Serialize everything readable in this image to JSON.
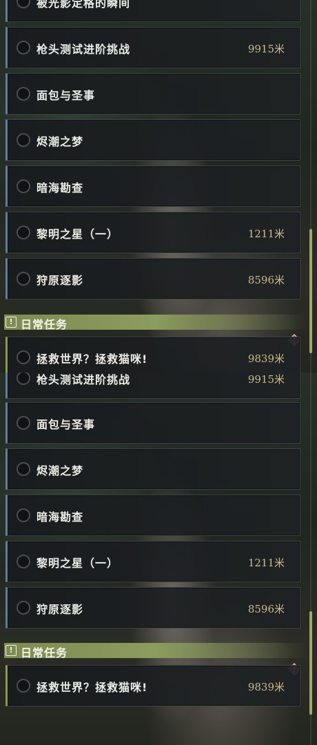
{
  "top_panel": {
    "partial_top_title": "被光影定格的瞬间",
    "quests": [
      {
        "title": "枪头测试进阶挑战",
        "distance": "9915米"
      },
      {
        "title": "面包与圣事",
        "distance": ""
      },
      {
        "title": "烬潮之梦",
        "distance": ""
      },
      {
        "title": "暗海勘查",
        "distance": ""
      },
      {
        "title": "黎明之星（一）",
        "distance": "1211米"
      },
      {
        "title": "狩原逐影",
        "distance": "8596米"
      }
    ],
    "section_title": "日常任务",
    "section_icon": "!",
    "daily_quest": {
      "title": "拯救世界？拯救猫咪!",
      "distance": "9839米"
    }
  },
  "bottom_panel": {
    "quests": [
      {
        "title": "枪头测试进阶挑战",
        "distance": "9915米"
      },
      {
        "title": "面包与圣事",
        "distance": ""
      },
      {
        "title": "烬潮之梦",
        "distance": ""
      },
      {
        "title": "暗海勘查",
        "distance": ""
      },
      {
        "title": "黎明之星（一）",
        "distance": "1211米"
      },
      {
        "title": "狩原逐影",
        "distance": "8596米"
      }
    ],
    "section_title": "日常任务",
    "section_icon": "!",
    "daily_quest": {
      "title": "拯救世界？拯救猫咪!",
      "distance": "9839米"
    }
  },
  "colors": {
    "quest_accent": "#5d7f9a",
    "daily_accent": "#8a9a52",
    "distance_text": "#cbbd8f",
    "alert": "#c83a52",
    "scrollbar": "#a7a46c"
  },
  "icons": {
    "status": "circle-outline-icon",
    "section": "exclamation-box-icon",
    "alert": "diamond-alert-icon"
  }
}
